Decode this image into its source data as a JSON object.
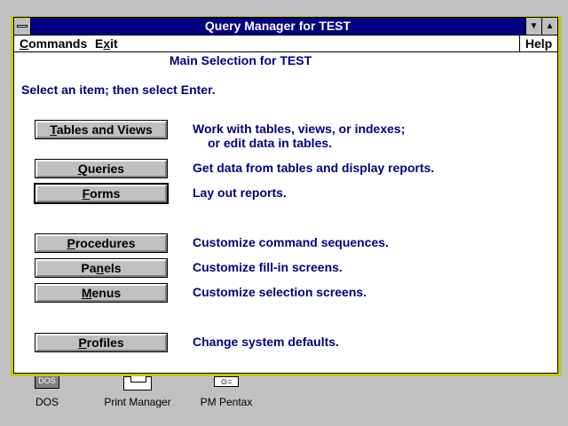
{
  "window": {
    "title": "Query Manager for TEST",
    "minimize_glyph": "▼",
    "maximize_glyph": "▲"
  },
  "menubar": {
    "commands_prefix": "C",
    "commands_rest": "ommands",
    "exit_prefix": "E",
    "exit_mnemonic": "x",
    "exit_rest": "it",
    "help": "Help"
  },
  "content": {
    "heading": "Main Selection for TEST",
    "instruction": "Select an item; then select Enter."
  },
  "items": [
    {
      "mnemonic": "T",
      "rest": "ables and Views",
      "desc_line1": "Work with tables, views, or indexes;",
      "desc_line2": "or edit data in tables."
    },
    {
      "mnemonic": "Q",
      "rest": "ueries",
      "desc_line1": "Get data from tables and display reports.",
      "desc_line2": ""
    },
    {
      "mnemonic": "F",
      "rest": "orms",
      "desc_line1": "Lay out reports.",
      "desc_line2": ""
    },
    {
      "mnemonic": "P",
      "rest": "rocedures",
      "desc_line1": "Customize command sequences.",
      "desc_line2": ""
    },
    {
      "prefix": "Pa",
      "mnemonic": "n",
      "rest": "els",
      "desc_line1": "Customize fill-in screens.",
      "desc_line2": ""
    },
    {
      "mnemonic": "M",
      "rest": "enus",
      "desc_line1": "Customize selection screens.",
      "desc_line2": ""
    },
    {
      "mnemonic": "P",
      "rest": "rofiles",
      "desc_line1": "Change system defaults.",
      "desc_line2": ""
    }
  ],
  "desktop_icons": [
    {
      "label": "DOS",
      "glyph_text": "DOS",
      "icon": "dos-icon"
    },
    {
      "label": "Print Manager",
      "icon": "printer-icon"
    },
    {
      "label": "PM Pentax",
      "glyph_text": "⊙=",
      "icon": "scanner-icon"
    }
  ],
  "colors": {
    "title_bar": "#000080",
    "window_frame": "#c8c800",
    "text_accent": "#000080",
    "desktop": "#c0c0c0"
  }
}
